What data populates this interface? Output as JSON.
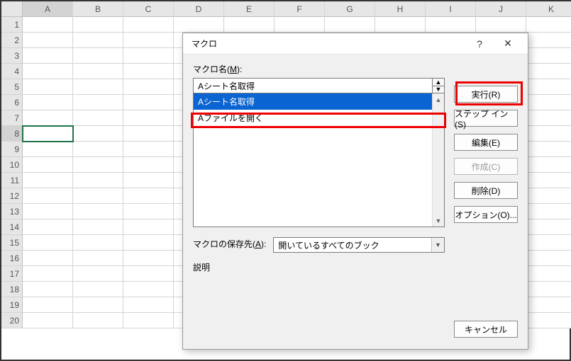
{
  "sheet": {
    "columns": [
      "A",
      "B",
      "C",
      "D",
      "E",
      "F",
      "G",
      "H",
      "I",
      "J",
      "K"
    ],
    "rows": [
      1,
      2,
      3,
      4,
      5,
      6,
      7,
      8,
      9,
      10,
      11,
      12,
      13,
      14,
      15,
      16,
      17,
      18,
      19,
      20
    ],
    "active_col": "A",
    "active_row": 8
  },
  "dialog": {
    "title": "マクロ",
    "help_glyph": "?",
    "close_glyph": "✕",
    "macro_name": {
      "label_prefix": "マクロ名(",
      "label_key": "M",
      "label_suffix": "):",
      "value": "Aシート名取得"
    },
    "macro_list": [
      {
        "label": "Aシート名取得",
        "selected": true
      },
      {
        "label": "Aファイルを開く",
        "selected": false
      }
    ],
    "store": {
      "label_prefix": "マクロの保存先(",
      "label_key": "A",
      "label_suffix": "):",
      "value": "開いているすべてのブック"
    },
    "description_label": "説明",
    "buttons": {
      "run": "実行(R)",
      "step": "ステップ イン(S)",
      "edit": "編集(E)",
      "create": "作成(C)",
      "delete": "削除(D)",
      "options": "オプション(O)...",
      "cancel": "キャンセル"
    }
  }
}
